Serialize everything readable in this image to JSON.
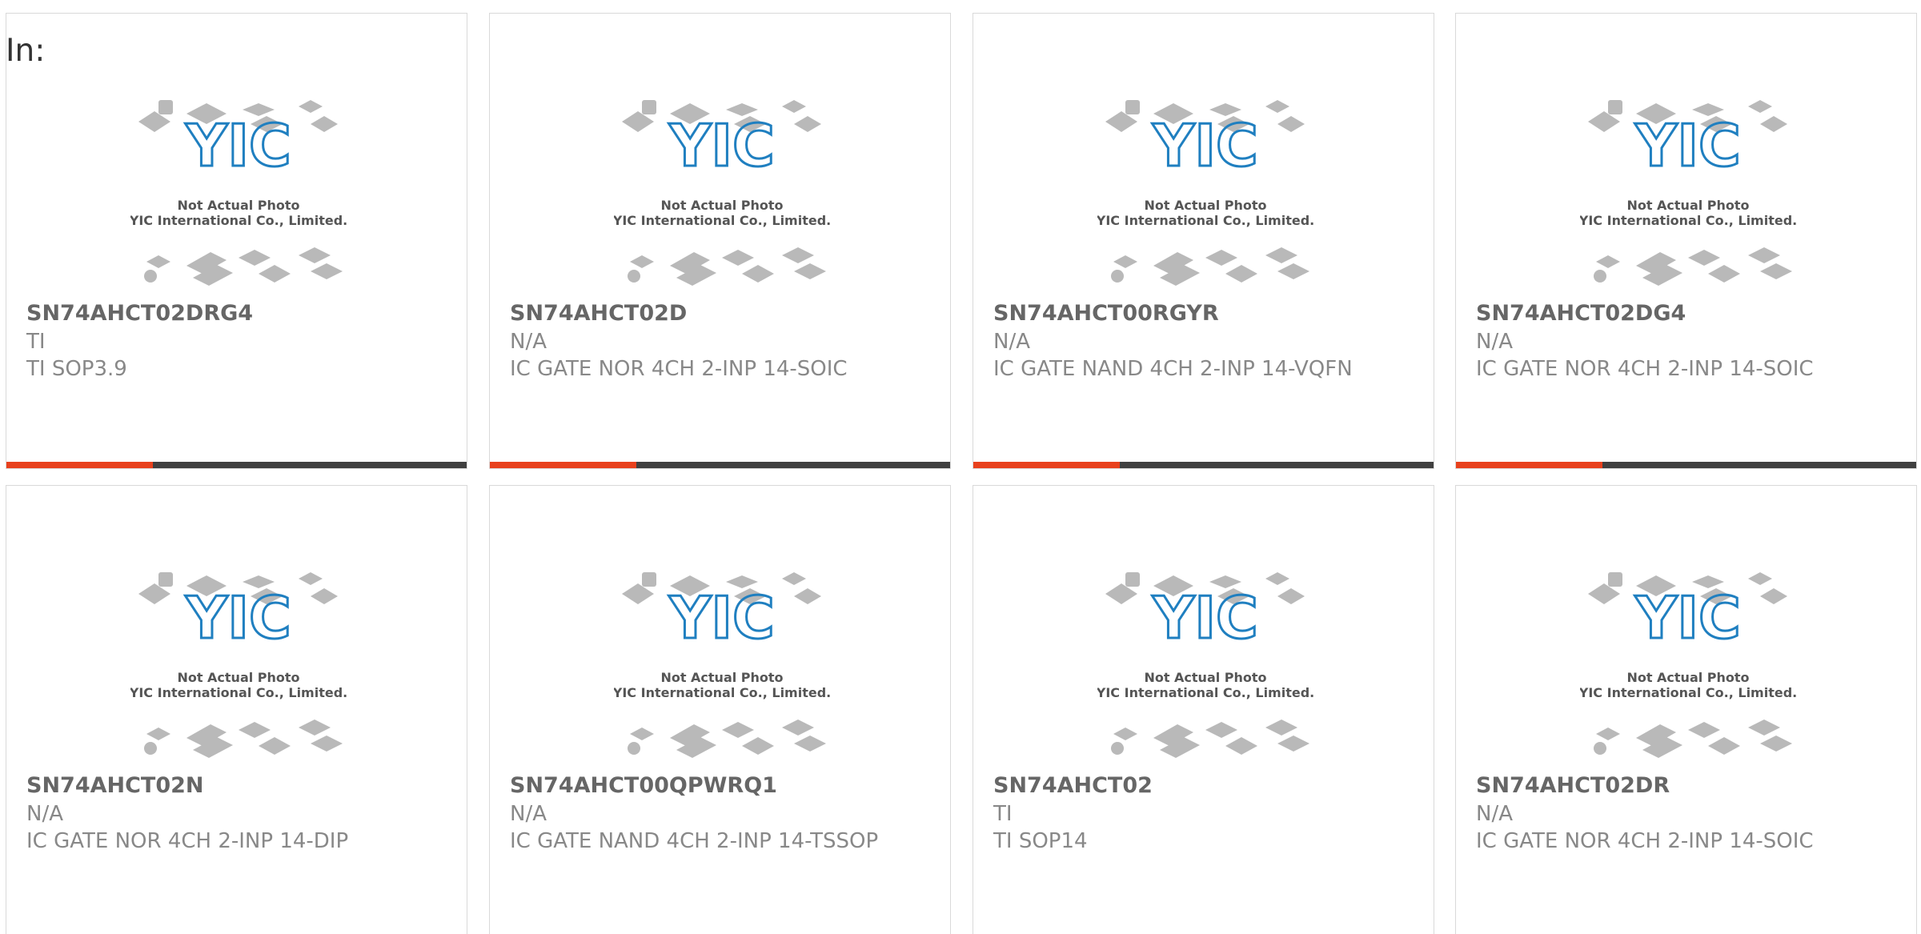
{
  "header": {
    "in_label": "In:"
  },
  "image": {
    "caption_line1": "Not Actual Photo",
    "caption_line2": "YIC International Co., Limited.",
    "logo": "YIC"
  },
  "colors": {
    "accent": "#e8411d",
    "bar": "#404040",
    "logo": "#1f7fc0"
  },
  "products": [
    {
      "part_number": "SN74AHCT02DRG4",
      "manufacturer": "TI",
      "description": "TI SOP3.9"
    },
    {
      "part_number": "SN74AHCT02D",
      "manufacturer": "N/A",
      "description": "IC GATE NOR 4CH 2-INP 14-SOIC"
    },
    {
      "part_number": "SN74AHCT00RGYR",
      "manufacturer": "N/A",
      "description": "IC GATE NAND 4CH 2-INP 14-VQFN"
    },
    {
      "part_number": "SN74AHCT02DG4",
      "manufacturer": "N/A",
      "description": "IC GATE NOR 4CH 2-INP 14-SOIC"
    },
    {
      "part_number": "SN74AHCT02N",
      "manufacturer": "N/A",
      "description": "IC GATE NOR 4CH 2-INP 14-DIP"
    },
    {
      "part_number": "SN74AHCT00QPWRQ1",
      "manufacturer": "N/A",
      "description": "IC GATE NAND 4CH 2-INP 14-TSSOP"
    },
    {
      "part_number": "SN74AHCT02",
      "manufacturer": "TI",
      "description": "TI SOP14"
    },
    {
      "part_number": "SN74AHCT02DR",
      "manufacturer": "N/A",
      "description": "IC GATE NOR 4CH 2-INP 14-SOIC"
    }
  ]
}
